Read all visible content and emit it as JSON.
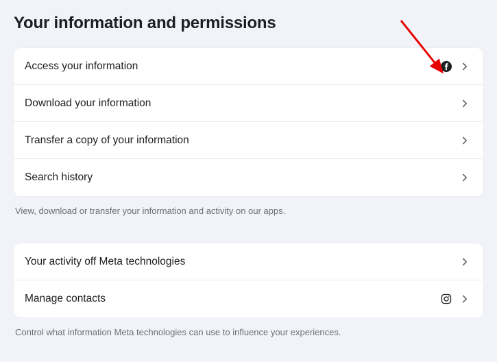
{
  "page": {
    "title": "Your information and permissions"
  },
  "section1": {
    "items": [
      {
        "label": "Access your information",
        "icon": "facebook"
      },
      {
        "label": "Download your information",
        "icon": null
      },
      {
        "label": "Transfer a copy of your information",
        "icon": null
      },
      {
        "label": "Search history",
        "icon": null
      }
    ],
    "caption": "View, download or transfer your information and activity on our apps."
  },
  "section2": {
    "items": [
      {
        "label": "Your activity off Meta technologies",
        "icon": null
      },
      {
        "label": "Manage contacts",
        "icon": "instagram"
      }
    ],
    "caption": "Control what information Meta technologies can use to influence your experiences."
  },
  "annotation": {
    "arrow_color": "#e60000"
  }
}
